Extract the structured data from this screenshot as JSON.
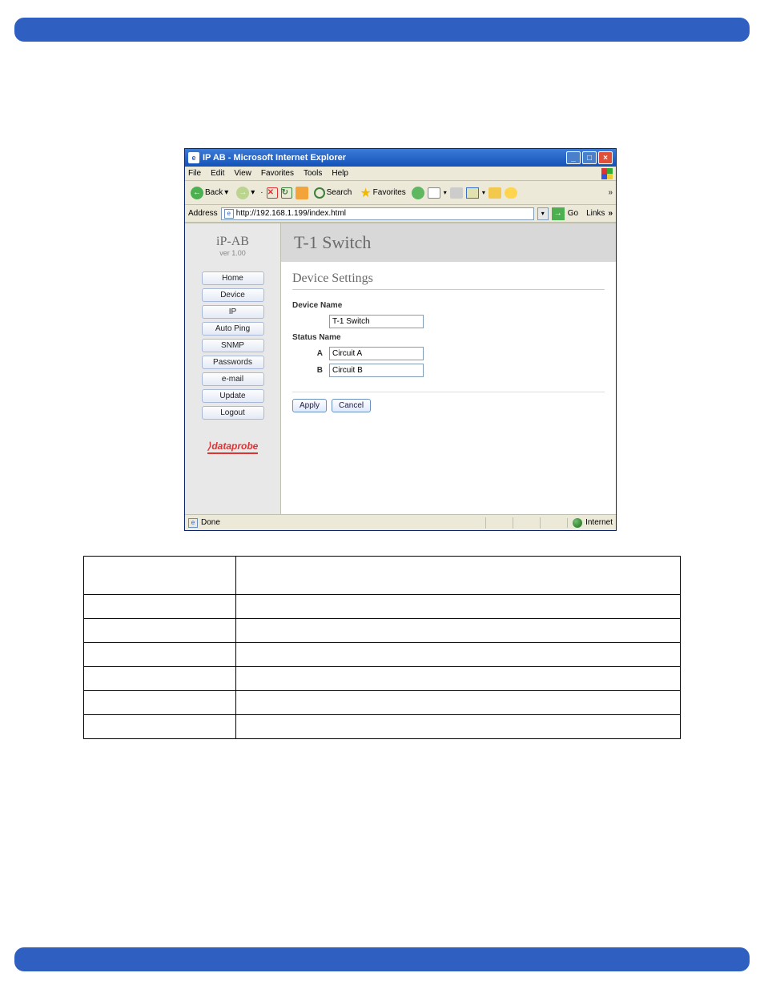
{
  "browser": {
    "title": "IP AB - Microsoft Internet Explorer",
    "menus": {
      "file": "File",
      "edit": "Edit",
      "view": "View",
      "favorites": "Favorites",
      "tools": "Tools",
      "help": "Help"
    },
    "toolbar": {
      "back": "Back",
      "search": "Search",
      "favorites": "Favorites"
    },
    "address_label": "Address",
    "url": "http://192.168.1.199/index.html",
    "go": "Go",
    "links": "Links",
    "status_done": "Done",
    "status_zone": "Internet"
  },
  "app": {
    "brand": "iP-AB",
    "version": "ver 1.00",
    "nav": {
      "home": "Home",
      "device": "Device",
      "ip": "IP",
      "autoping": "Auto Ping",
      "snmp": "SNMP",
      "passwords": "Passwords",
      "email": "e-mail",
      "update": "Update",
      "logout": "Logout"
    },
    "logo": "dataprobe",
    "page_title": "T-1 Switch",
    "section_title": "Device Settings",
    "labels": {
      "device_name": "Device Name",
      "status_name": "Status Name",
      "a": "A",
      "b": "B"
    },
    "fields": {
      "device_name": "T-1 Switch",
      "status_a": "Circuit A",
      "status_b": "Circuit B"
    },
    "buttons": {
      "apply": "Apply",
      "cancel": "Cancel"
    }
  },
  "doc_table": {
    "rows": [
      [
        "",
        ""
      ],
      [
        "",
        ""
      ],
      [
        "",
        ""
      ],
      [
        "",
        ""
      ],
      [
        "",
        ""
      ],
      [
        "",
        ""
      ],
      [
        "",
        ""
      ]
    ]
  }
}
